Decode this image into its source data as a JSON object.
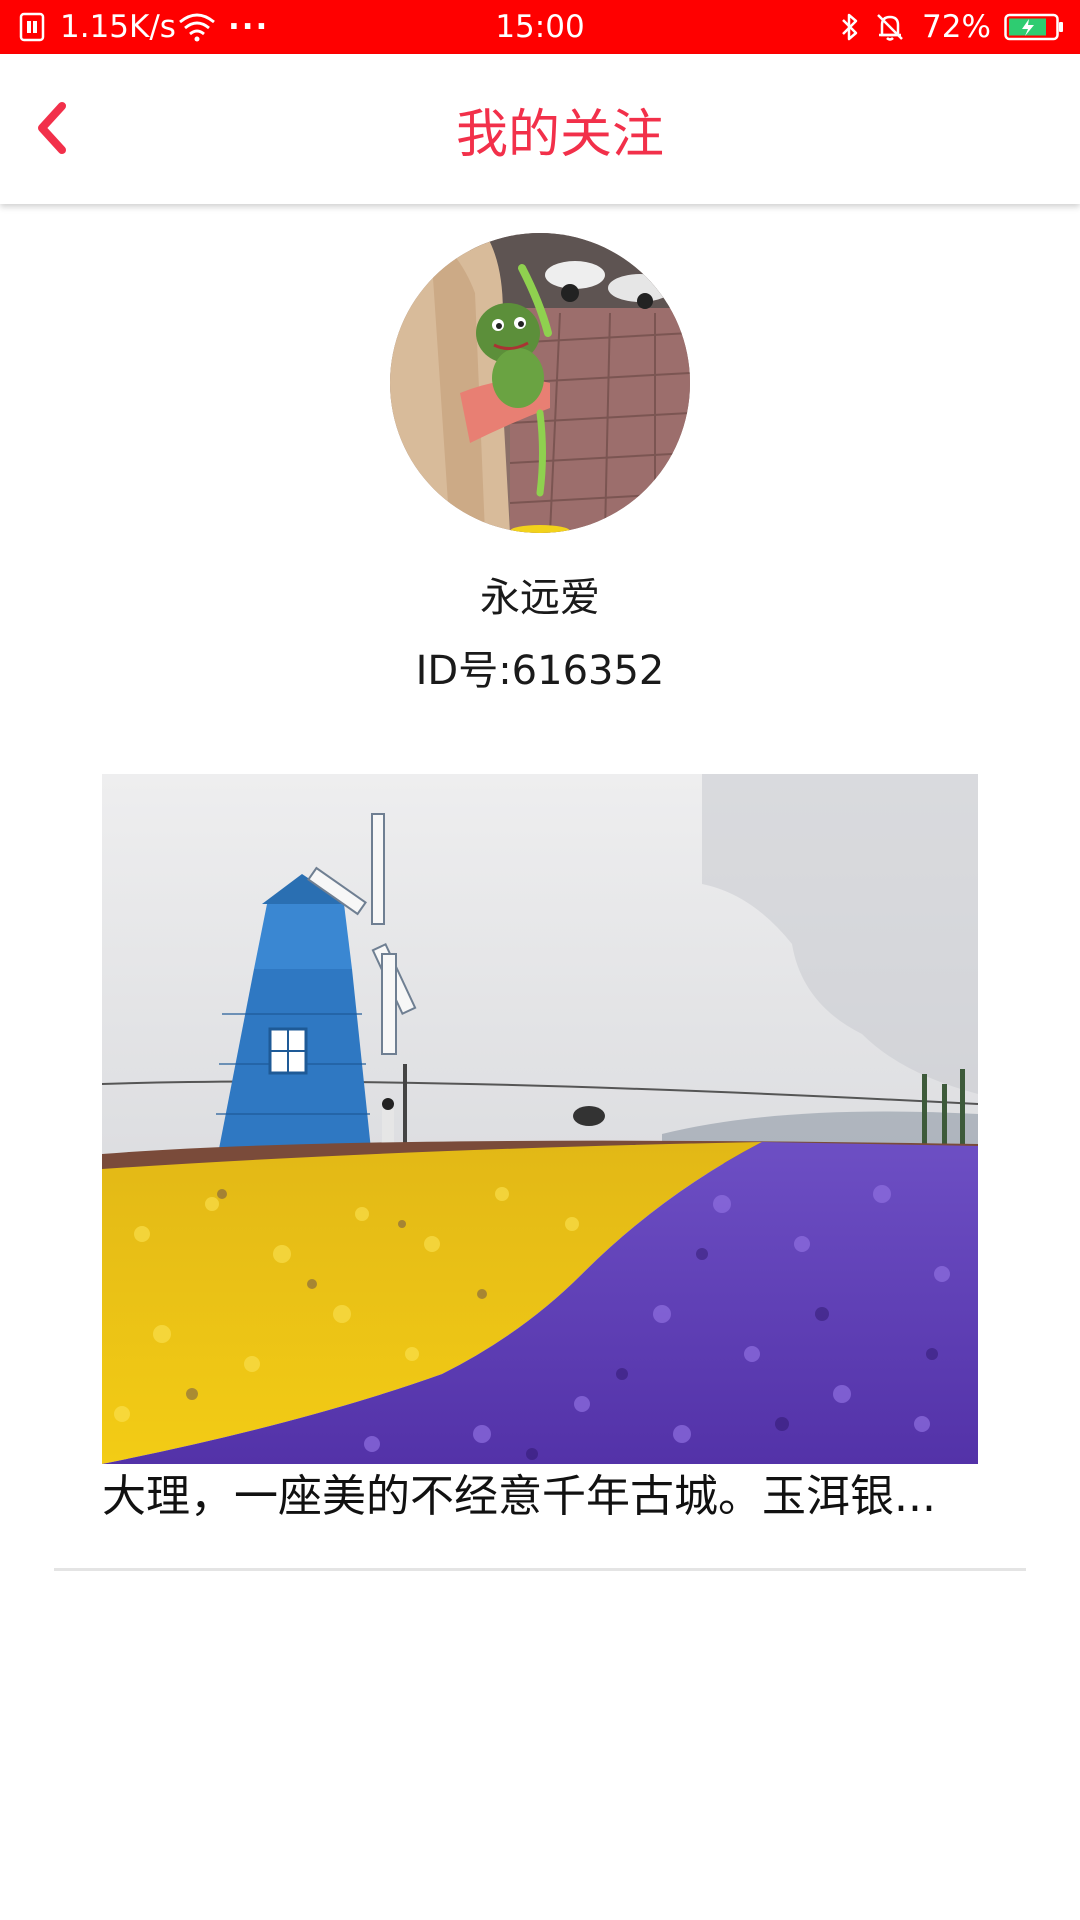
{
  "status_bar": {
    "speed": "1.15K/s",
    "dots": "···",
    "time": "15:00",
    "battery": "72%",
    "background_color": "#ff0000",
    "icons": [
      "sim-icon",
      "wifi-icon",
      "bluetooth-icon",
      "bell-off-icon",
      "battery-charging-icon"
    ]
  },
  "header": {
    "title": "我的关注",
    "back_icon": "chevron-left-icon",
    "accent_color": "#f2304a"
  },
  "profile": {
    "name": "永远爱",
    "id_text": "ID号:616352"
  },
  "post": {
    "caption": "大理，一座美的不经意千年古城。玉洱银..."
  }
}
